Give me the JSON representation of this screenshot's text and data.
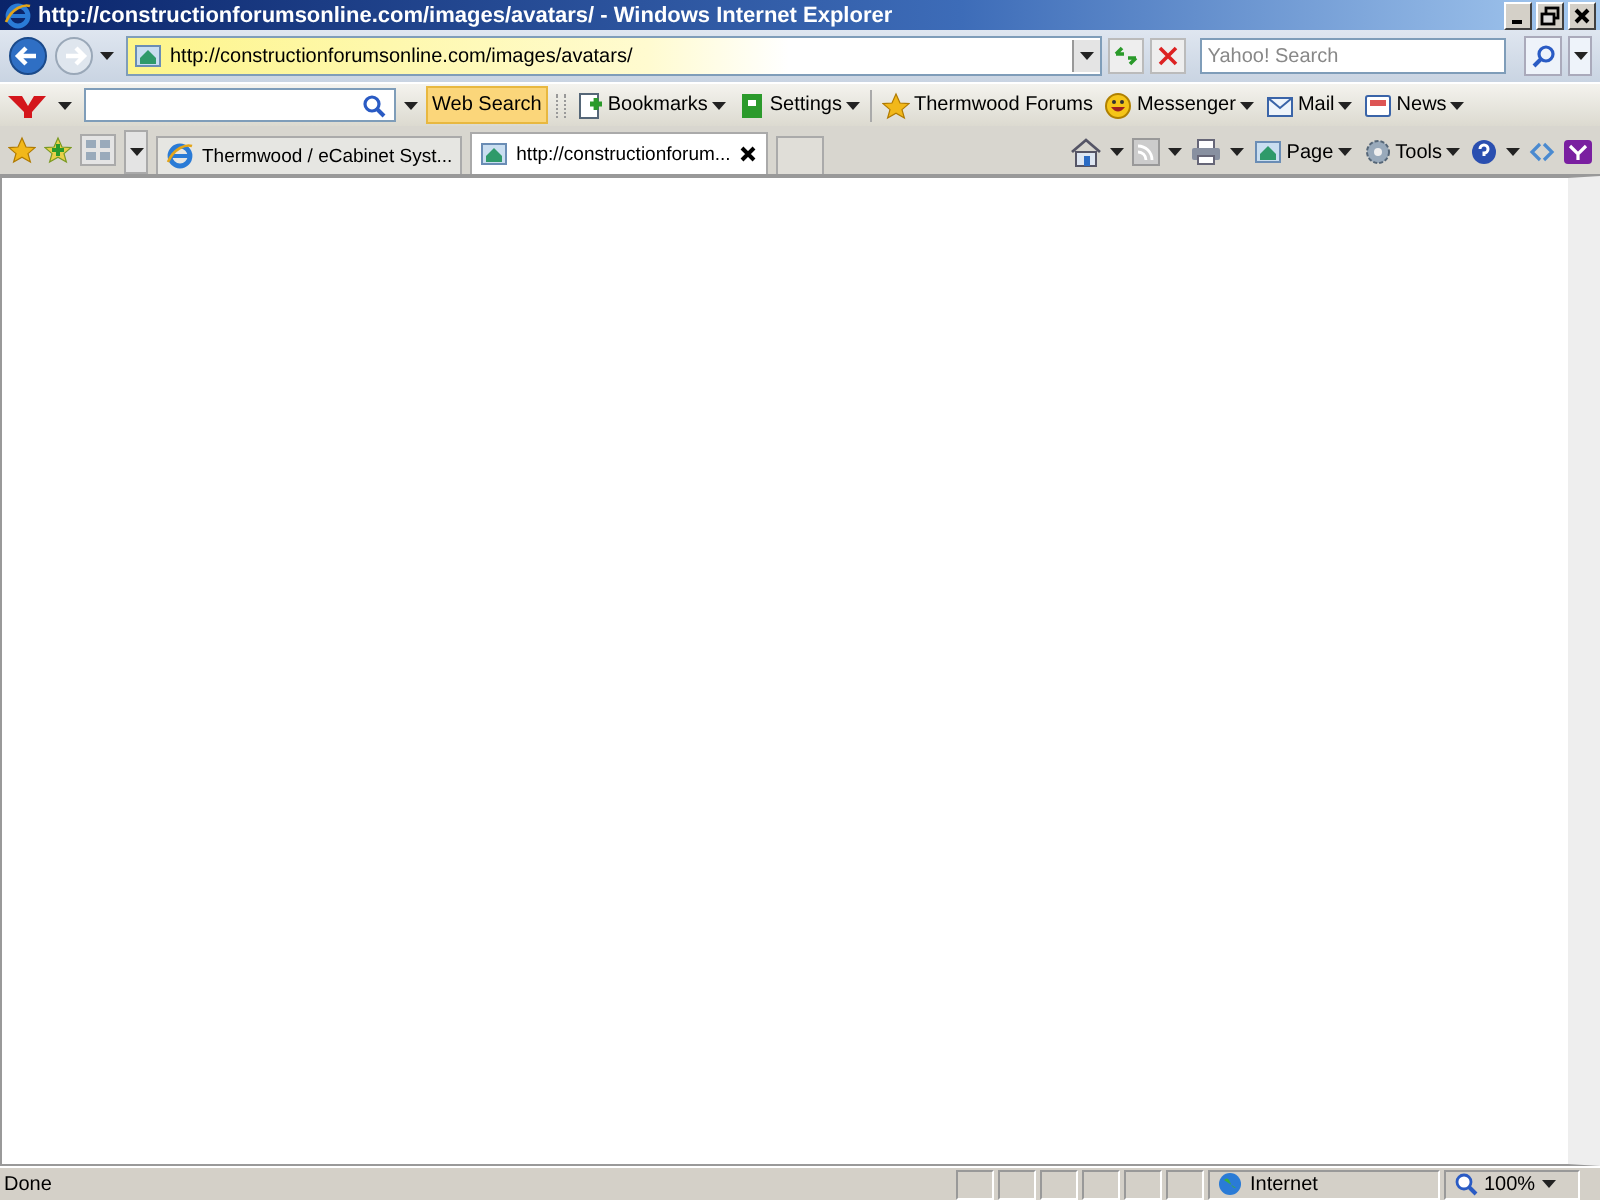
{
  "window": {
    "title": "http://constructionforumsonline.com/images/avatars/ - Windows Internet Explorer"
  },
  "address_bar": {
    "url": "http://constructionforumsonline.com/images/avatars/"
  },
  "search": {
    "placeholder": "Yahoo! Search"
  },
  "yahoo_toolbar": {
    "search_button": "Web Search",
    "items": [
      {
        "label": "Bookmarks",
        "dropdown": true
      },
      {
        "label": "Settings",
        "dropdown": true
      },
      {
        "label": "Thermwood Forums",
        "dropdown": false
      },
      {
        "label": "Messenger",
        "dropdown": true
      },
      {
        "label": "Mail",
        "dropdown": true
      },
      {
        "label": "News",
        "dropdown": true
      }
    ]
  },
  "tabs": [
    {
      "label": "Thermwood / eCabinet Syst...",
      "selected": false
    },
    {
      "label": "http://constructionforum...",
      "selected": true
    }
  ],
  "command_bar": [
    {
      "label": "Page"
    },
    {
      "label": "Tools"
    }
  ],
  "status_bar": {
    "text": "Done",
    "zone": "Internet",
    "zoom": "100%"
  }
}
